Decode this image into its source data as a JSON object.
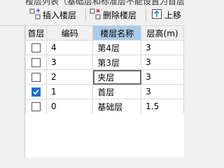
{
  "window": {
    "title_fragment": "楼层列表（基础层和标准层不能设置为首层）"
  },
  "toolbar": {
    "insert_label": "插入楼层",
    "delete_label": "删除楼层",
    "moveup_label": "上移"
  },
  "table": {
    "columns": [
      "首层",
      "编码",
      "楼层名称",
      "层高(m)"
    ],
    "selected_column": "楼层名称",
    "rows": [
      {
        "first_floor": false,
        "code": "4",
        "name": "第4层",
        "height": "3"
      },
      {
        "first_floor": false,
        "code": "3",
        "name": "第3层",
        "height": "3"
      },
      {
        "first_floor": false,
        "code": "2",
        "name": "夹层",
        "height": "3",
        "editing": true
      },
      {
        "first_floor": true,
        "code": "1",
        "name": "首层",
        "height": "3"
      },
      {
        "first_floor": false,
        "code": "0",
        "name": "基础层",
        "height": "1.5"
      }
    ]
  },
  "colors": {
    "accent": "#1e6fd9",
    "header_selected": "#a9cde8",
    "insert_icon": "#1e6fd9",
    "delete_icon": "#d93025"
  }
}
